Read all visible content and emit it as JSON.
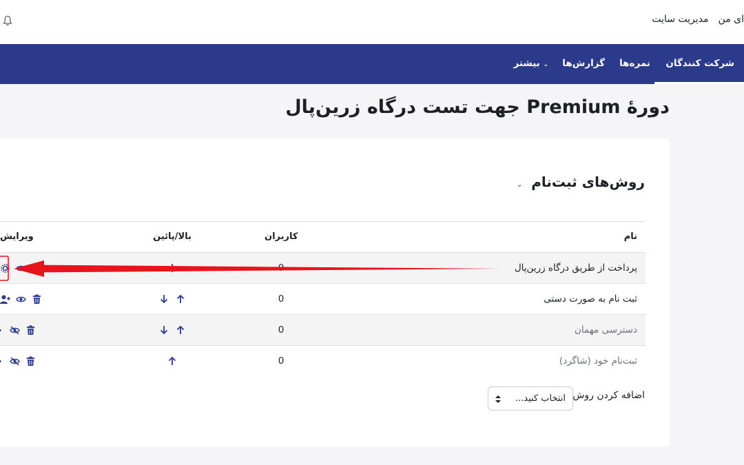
{
  "topbar": {
    "site_admin": "مدیریت سایت",
    "my_courses": "ای من"
  },
  "nav": {
    "tabs": [
      {
        "label": "شرکت کنندگان",
        "active": true
      },
      {
        "label": "نمره‌ها",
        "active": false
      },
      {
        "label": "گزارش‌ها",
        "active": false
      },
      {
        "label": "بیشتر",
        "active": false
      }
    ]
  },
  "page": {
    "title": "دورهٔ Premium جهت تست درگاه زرین‌پال"
  },
  "section": {
    "title": "روش‌های ثبت‌نام"
  },
  "table": {
    "headers": {
      "name": "نام",
      "users": "کاربران",
      "updown": "بالا/پائین",
      "edit": "ویرایش"
    },
    "rows": [
      {
        "name": "پرداخت از طریق درگاه زرین‌پال",
        "users": "0",
        "enabled": true
      },
      {
        "name": "ثبت نام به صورت دستی",
        "users": "0",
        "enabled": true
      },
      {
        "name": "دسترسی مهمان",
        "users": "0",
        "enabled": false
      },
      {
        "name": "ثبت‌نام خود (شاگرد)",
        "users": "0",
        "enabled": false
      }
    ]
  },
  "add_method": {
    "label": "اضافه کردن روش",
    "select_value": "انتخاب کنید..."
  },
  "colors": {
    "nav_bg": "#2c3a8c",
    "icon": "#2c3a8c",
    "annotation": "#e8141c"
  }
}
